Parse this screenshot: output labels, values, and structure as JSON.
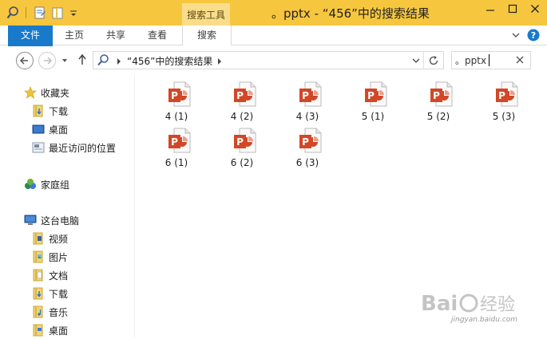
{
  "window": {
    "title": "。pptx - “456”中的搜索结果",
    "tool_tab_header": "搜索工具"
  },
  "ribbon": {
    "tabs": [
      {
        "label": "文件"
      },
      {
        "label": "主页"
      },
      {
        "label": "共享"
      },
      {
        "label": "查看"
      },
      {
        "label": "搜索"
      }
    ]
  },
  "address": {
    "crumb": "“456”中的搜索结果"
  },
  "search": {
    "value": "。pptx"
  },
  "sidebar": {
    "favorites": {
      "label": "收藏夹",
      "items": [
        {
          "label": "下载",
          "icon": "download-folder-icon"
        },
        {
          "label": "桌面",
          "icon": "desktop-icon"
        },
        {
          "label": "最近访问的位置",
          "icon": "recent-places-icon"
        }
      ]
    },
    "homegroup": {
      "label": "家庭组"
    },
    "thispc": {
      "label": "这台电脑",
      "items": [
        {
          "label": "视频",
          "icon": "videos-folder-icon"
        },
        {
          "label": "图片",
          "icon": "pictures-folder-icon"
        },
        {
          "label": "文档",
          "icon": "documents-folder-icon"
        },
        {
          "label": "下载",
          "icon": "download-folder-icon"
        },
        {
          "label": "音乐",
          "icon": "music-folder-icon"
        },
        {
          "label": "桌面",
          "icon": "desktop-folder-icon"
        }
      ]
    }
  },
  "files": [
    {
      "name": "4 (1)"
    },
    {
      "name": "4 (2)"
    },
    {
      "name": "4 (3)"
    },
    {
      "name": "5 (1)"
    },
    {
      "name": "5 (2)"
    },
    {
      "name": "5 (3)"
    },
    {
      "name": "6 (1)"
    },
    {
      "name": "6 (2)"
    },
    {
      "name": "6 (3)"
    }
  ],
  "colors": {
    "titlebar": "#f6c63e",
    "file_tab": "#1979ca",
    "ppt_badge": "#d24726"
  },
  "watermark": {
    "url": "jingyan.baidu.com"
  }
}
